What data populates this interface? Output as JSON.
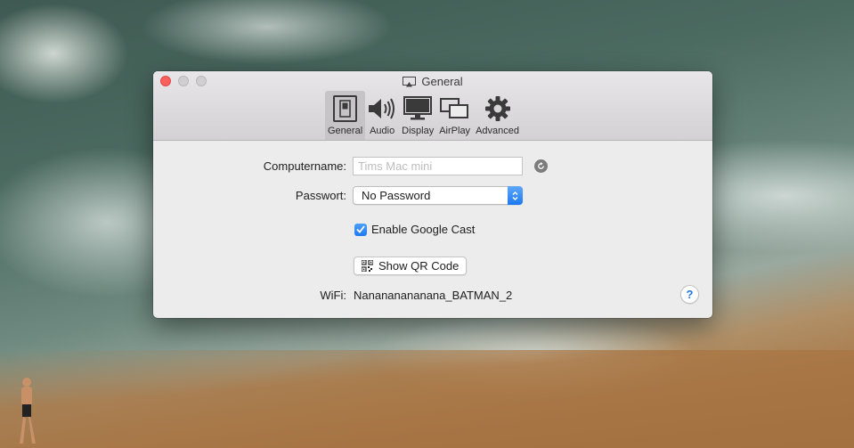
{
  "window": {
    "title": "General",
    "tabs": [
      {
        "id": "general",
        "label": "General",
        "icon": "switch-icon",
        "active": true
      },
      {
        "id": "audio",
        "label": "Audio",
        "icon": "speaker-icon",
        "active": false
      },
      {
        "id": "display",
        "label": "Display",
        "icon": "monitor-icon",
        "active": false
      },
      {
        "id": "airplay",
        "label": "AirPlay",
        "icon": "airplay-screens-icon",
        "active": false
      },
      {
        "id": "advanced",
        "label": "Advanced",
        "icon": "gear-icon",
        "active": false
      }
    ]
  },
  "form": {
    "computername_label": "Computername:",
    "computername_value": "",
    "computername_placeholder": "Tims Mac mini",
    "password_label": "Passwort:",
    "password_value": "No Password",
    "google_cast_label": "Enable Google Cast",
    "google_cast_checked": true,
    "qr_button_label": "Show QR Code",
    "wifi_label": "WiFi:",
    "wifi_value": "Nanananananana_BATMAN_2",
    "help_label": "?"
  },
  "colors": {
    "accent": "#1f7af2",
    "close_light": "#fc605c"
  }
}
